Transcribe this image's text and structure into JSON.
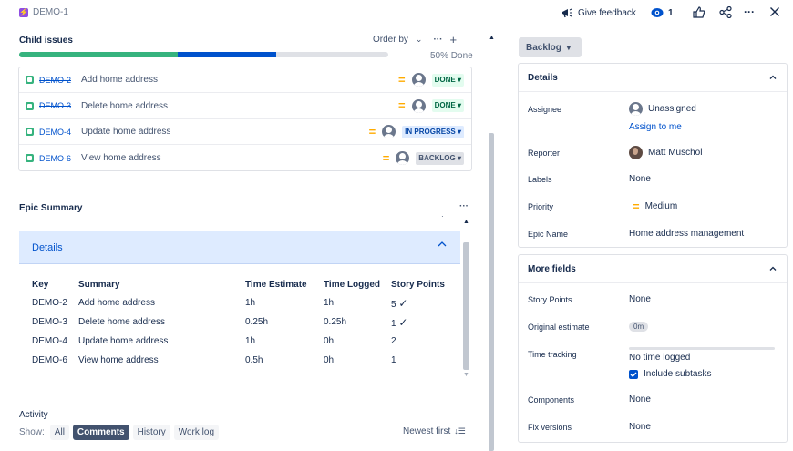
{
  "breadcrumb": {
    "issue_key": "DEMO-1"
  },
  "top_actions": {
    "feedback_label": "Give feedback",
    "watch_count": "1"
  },
  "child_issues": {
    "title": "Child issues",
    "order_by_label": "Order by",
    "progress_text": "50% Done",
    "progress": {
      "done_fraction": 0.5,
      "in_progress_fraction": 0.25
    },
    "items": [
      {
        "key": "DEMO-2",
        "summary": "Add home address",
        "status": "DONE",
        "done": true
      },
      {
        "key": "DEMO-3",
        "summary": "Delete home address",
        "status": "DONE",
        "done": true
      },
      {
        "key": "DEMO-4",
        "summary": "Update home address",
        "status": "IN PROGRESS",
        "done": false
      },
      {
        "key": "DEMO-6",
        "summary": "View home address",
        "status": "BACKLOG",
        "done": false
      }
    ]
  },
  "epic_summary": {
    "title": "Epic Summary",
    "details_label": "Details",
    "columns": [
      "Key",
      "Summary",
      "Time Estimate",
      "Time Logged",
      "Story Points"
    ],
    "rows": [
      {
        "key": "DEMO-2",
        "summary": "Add home address",
        "estimate": "1h",
        "logged": "1h",
        "points": "5",
        "check": true
      },
      {
        "key": "DEMO-3",
        "summary": "Delete home address",
        "estimate": "0.25h",
        "logged": "0.25h",
        "points": "1",
        "check": true
      },
      {
        "key": "DEMO-4",
        "summary": "Update home address",
        "estimate": "1h",
        "logged": "0h",
        "points": "2",
        "check": false
      },
      {
        "key": "DEMO-6",
        "summary": "View home address",
        "estimate": "0.5h",
        "logged": "0h",
        "points": "1",
        "check": false
      }
    ]
  },
  "activity": {
    "title": "Activity",
    "show_label": "Show:",
    "tabs": [
      "All",
      "Comments",
      "History",
      "Work log"
    ],
    "selected_tab": "Comments",
    "sort_label": "Newest first"
  },
  "sidebar": {
    "status_button": "Backlog",
    "details": {
      "title": "Details",
      "assignee_label": "Assignee",
      "assignee_value": "Unassigned",
      "assign_to_me": "Assign to me",
      "reporter_label": "Reporter",
      "reporter_value": "Matt Muschol",
      "labels_label": "Labels",
      "labels_value": "None",
      "priority_label": "Priority",
      "priority_value": "Medium",
      "epic_name_label": "Epic Name",
      "epic_name_value": "Home address management"
    },
    "more_fields": {
      "title": "More fields",
      "story_points_label": "Story Points",
      "story_points_value": "None",
      "original_estimate_label": "Original estimate",
      "original_estimate_value": "0m",
      "time_tracking_label": "Time tracking",
      "time_tracking_value": "No time logged",
      "include_subtasks_label": "Include subtasks",
      "components_label": "Components",
      "components_value": "None",
      "fix_versions_label": "Fix versions",
      "fix_versions_value": "None"
    }
  },
  "colors": {
    "done_green": "#36b37e",
    "progress_blue": "#0052cc",
    "link": "#0052cc",
    "priority_medium": "#ffab00"
  }
}
